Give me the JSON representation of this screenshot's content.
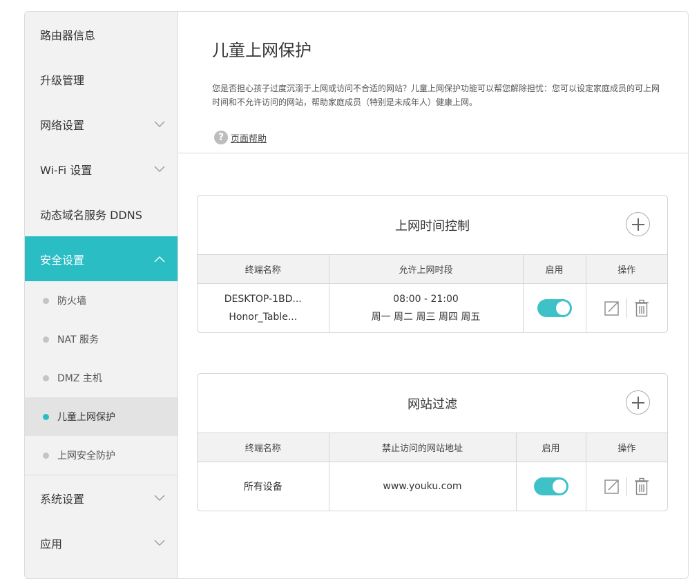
{
  "sidebar": {
    "items": [
      {
        "label": "路由器信息"
      },
      {
        "label": "升级管理"
      },
      {
        "label": "网络设置"
      },
      {
        "label": "Wi-Fi 设置"
      },
      {
        "label": "动态域名服务 DDNS"
      },
      {
        "label": "安全设置"
      },
      {
        "label": "系统设置"
      },
      {
        "label": "应用"
      }
    ],
    "security_sub": [
      {
        "label": "防火墙"
      },
      {
        "label": "NAT 服务"
      },
      {
        "label": "DMZ 主机"
      },
      {
        "label": "儿童上网保护"
      },
      {
        "label": "上网安全防护"
      }
    ]
  },
  "header": {
    "title": "儿童上网保护",
    "description": "您是否担心孩子过度沉溺于上网或访问不合适的网站？儿童上网保护功能可以帮您解除担忧：您可以设定家庭成员的可上网时间和不允许访问的网站，帮助家庭成员（特别是未成年人）健康上网。",
    "help_label": "页面帮助",
    "help_icon": "?"
  },
  "time_control": {
    "title": "上网时间控制",
    "columns": [
      "终端名称",
      "允许上网时段",
      "启用",
      "操作"
    ],
    "rows": [
      {
        "devices": [
          "DESKTOP-1BD...",
          "Honor_Table..."
        ],
        "time": "08:00 - 21:00",
        "days": "周一 周二 周三 周四 周五",
        "enabled": true
      }
    ]
  },
  "site_filter": {
    "title": "网站过滤",
    "columns": [
      "终端名称",
      "禁止访问的网站地址",
      "启用",
      "操作"
    ],
    "rows": [
      {
        "device": "所有设备",
        "site": "www.youku.com",
        "enabled": true
      }
    ]
  },
  "colors": {
    "accent": "#2bbdc4",
    "toggle_on": "#3fc1c8",
    "sidebar_bg": "#f2f2f2"
  },
  "icons": [
    "chevron-down-icon",
    "chevron-up-icon",
    "help-icon",
    "plus-icon",
    "edit-icon",
    "trash-icon"
  ]
}
